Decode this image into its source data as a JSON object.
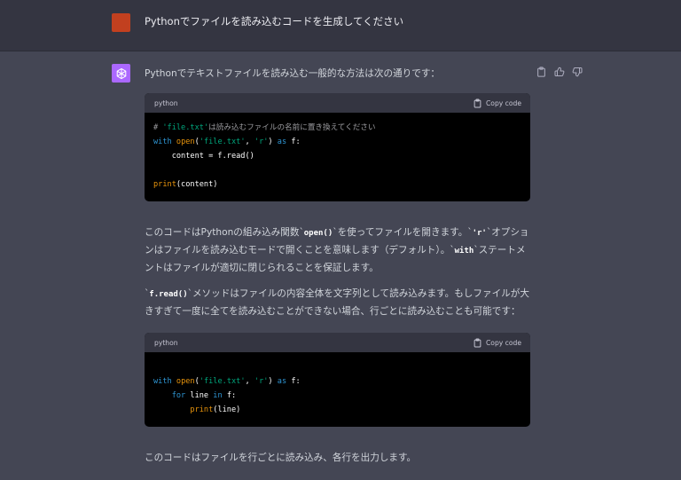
{
  "user_message": {
    "text": "Pythonでファイルを読み込むコードを生成してください"
  },
  "assistant": {
    "intro": "Pythonでテキストファイルを読み込む一般的な方法は次の通りです：",
    "code_blocks": [
      {
        "language": "python",
        "copy_label": "Copy code",
        "lines": {
          "l1": {
            "a": "# ",
            "b": "'file.txt'",
            "c": "は読み込むファイルの名前に置き換えてください"
          },
          "l2": {
            "a": "with",
            "b": " ",
            "c": "open",
            "d": "(",
            "e": "'file.txt'",
            "f": ", ",
            "g": "'r'",
            "h": ") ",
            "i": "as",
            "j": " f:"
          },
          "l3": {
            "a": "    content = f.read()"
          },
          "l5": {
            "a": "print",
            "b": "(content)"
          }
        }
      },
      {
        "language": "python",
        "copy_label": "Copy code",
        "lines": {
          "l1": {
            "a": "with",
            "b": " ",
            "c": "open",
            "d": "(",
            "e": "'file.txt'",
            "f": ", ",
            "g": "'r'",
            "h": ") ",
            "i": "as",
            "j": " f:"
          },
          "l2": {
            "a": "    ",
            "b": "for",
            "c": " line ",
            "d": "in",
            "e": " f:"
          },
          "l3": {
            "a": "        ",
            "b": "print",
            "c": "(line)"
          }
        }
      }
    ],
    "para2": {
      "s1": "このコードはPythonの組み込み関数`",
      "c1": "open()",
      "s2": "`を使ってファイルを開きます。`",
      "c2": "'r'",
      "s3": "`オプションはファイルを読み込むモードで開くことを意味します（デフォルト）。`",
      "c3": "with",
      "s4": "`ステートメントはファイルが適切に閉じられることを保証します。"
    },
    "para3": {
      "s1": "`",
      "c1": "f.read()",
      "s2": "`メソッドはファイルの内容全体を文字列として読み込みます。もしファイルが大きすぎて一度に全てを読み込むことができない場合、行ごとに読み込むことも可能です："
    },
    "outro": "このコードはファイルを行ごとに読み込み、各行を出力します。"
  },
  "colors": {
    "page_bg": "#444654",
    "user_row_bg": "#343541",
    "user_avatar": "#c2401f",
    "bot_avatar": "#ab68ff",
    "keyword": "#2e95d3",
    "builtin": "#e9950c",
    "string": "#00a67d"
  },
  "icons": [
    "openai-logo-icon",
    "clipboard-icon",
    "thumbs-up-icon",
    "thumbs-down-icon"
  ]
}
